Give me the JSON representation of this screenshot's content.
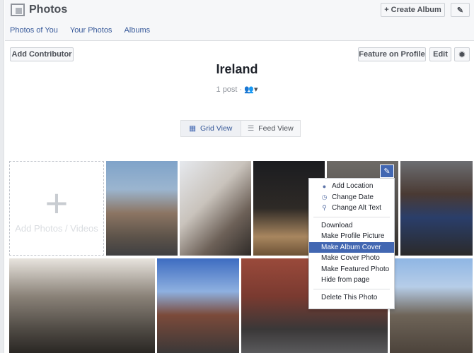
{
  "header": {
    "title": "Photos",
    "create_album": "+ Create Album",
    "edit_icon": "pencil-icon",
    "tabs": [
      "Photos of You",
      "Your Photos",
      "Albums"
    ]
  },
  "toolbar": {
    "add_contributor": "Add Contributor",
    "feature_on_profile": "Feature on Profile",
    "edit": "Edit",
    "settings_icon": "gear-icon"
  },
  "album": {
    "title": "Ireland",
    "meta": "1 post ·",
    "privacy_icon": "friends-icon"
  },
  "views": {
    "grid": "Grid View",
    "feed": "Feed View"
  },
  "grid": {
    "add_label": "Add Photos / Videos"
  },
  "menu": {
    "items": [
      "Add Location",
      "Change Date",
      "Change Alt Text",
      "Download",
      "Make Profile Picture",
      "Make Album Cover",
      "Make Cover Photo",
      "Make Featured Photo",
      "Hide from page",
      "Delete This Photo"
    ],
    "highlighted": "Make Album Cover"
  },
  "colors": {
    "accent": "#4267b2",
    "link": "#365899"
  }
}
